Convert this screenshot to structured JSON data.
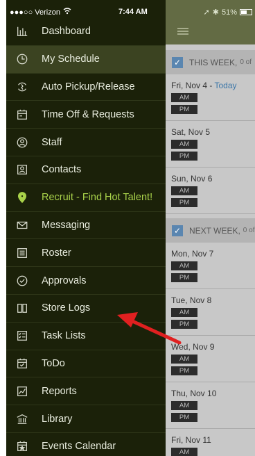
{
  "status_bar": {
    "carrier": "●●●○○ Verizon",
    "time": "7:44 AM",
    "battery": "51%"
  },
  "sidebar": {
    "items": [
      {
        "label": "Dashboard",
        "icon": "bar-chart-icon"
      },
      {
        "label": "My Schedule",
        "icon": "clock-icon",
        "active": true
      },
      {
        "label": "Auto Pickup/Release",
        "icon": "refresh-icon"
      },
      {
        "label": "Time Off & Requests",
        "icon": "calendar-icon"
      },
      {
        "label": "Staff",
        "icon": "person-circle-icon"
      },
      {
        "label": "Contacts",
        "icon": "contact-card-icon"
      },
      {
        "label": "Recruit - Find Hot Talent!",
        "icon": "map-pin-icon",
        "highlight": true
      },
      {
        "label": "Messaging",
        "icon": "envelope-icon"
      },
      {
        "label": "Roster",
        "icon": "list-icon"
      },
      {
        "label": "Approvals",
        "icon": "check-circle-icon"
      },
      {
        "label": "Store Logs",
        "icon": "book-icon"
      },
      {
        "label": "Task Lists",
        "icon": "checklist-icon"
      },
      {
        "label": "ToDo",
        "icon": "todo-calendar-icon"
      },
      {
        "label": "Reports",
        "icon": "line-chart-icon"
      },
      {
        "label": "Library",
        "icon": "library-icon"
      },
      {
        "label": "Events Calendar",
        "icon": "star-calendar-icon"
      }
    ]
  },
  "schedule": {
    "this_week": {
      "label": "THIS WEEK,",
      "sub": "0 of"
    },
    "next_week": {
      "label": "NEXT WEEK,",
      "sub": "0 of"
    },
    "am_label": "AM",
    "pm_label": "PM",
    "days": [
      {
        "label": "Fri, Nov 4 - ",
        "today": "Today"
      },
      {
        "label": "Sat, Nov 5"
      },
      {
        "label": "Sun, Nov 6"
      },
      {
        "label": "Mon, Nov 7"
      },
      {
        "label": "Tue, Nov 8"
      },
      {
        "label": "Wed, Nov 9"
      },
      {
        "label": "Thu, Nov 10"
      },
      {
        "label": "Fri, Nov 11"
      }
    ]
  },
  "colors": {
    "sidebar_bg": "#1b2109",
    "active_bg": "#3b4321",
    "recruit": "#a9d24a",
    "arrow": "#e02020"
  }
}
